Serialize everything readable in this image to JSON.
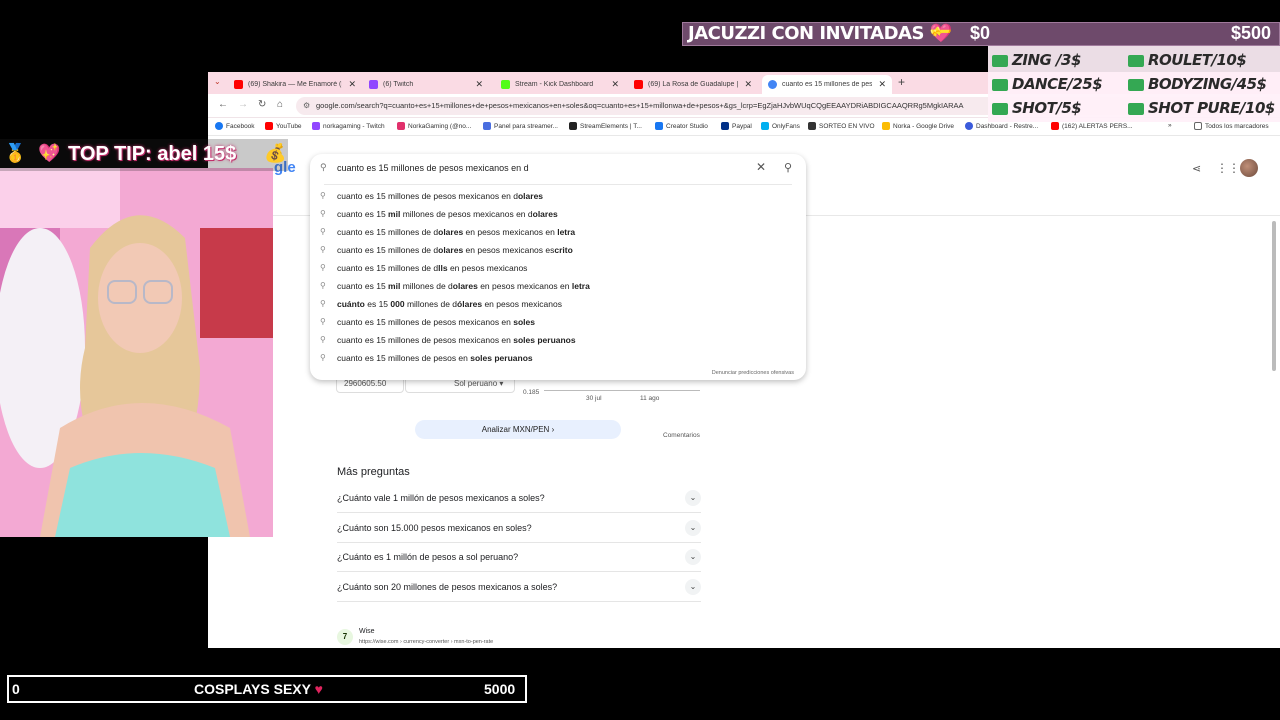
{
  "browser": {
    "tabs": [
      {
        "label": "(69) Shakira — Me Enamoré (Le",
        "color": "#ff0000"
      },
      {
        "label": "(6) Twitch",
        "color": "#9146ff"
      },
      {
        "label": "Stream - Kick Dashboard",
        "color": "#53fc18"
      },
      {
        "label": "(69) La Rosa de Guadalupe | EL",
        "color": "#ff0000"
      },
      {
        "label": "cuanto es 15 millones de pesos",
        "color": "#4285f4"
      }
    ],
    "url": "google.com/search?q=cuanto+es+15+millones+de+pesos+mexicanos+en+soles&oq=cuanto+es+15+millonwa+de+pesos+&gs_lcrp=EgZjaHJvbWUqCQgEEAAYDRiABDIGCAAQRRg5MgkIARAA",
    "bookmarks": [
      {
        "label": "Facebook",
        "color": "#1877f2"
      },
      {
        "label": "YouTube",
        "color": "#ff0000"
      },
      {
        "label": "norkagaming - Twitch",
        "color": "#9146ff"
      },
      {
        "label": "NorkaGaming (@no...",
        "color": "#e1306c"
      },
      {
        "label": "Panel para streamer...",
        "color": "#4a6ee0"
      },
      {
        "label": "StreamElements | T...",
        "color": "#222222"
      },
      {
        "label": "Creator Studio",
        "color": "#1877f2"
      },
      {
        "label": "Paypal",
        "color": "#003087"
      },
      {
        "label": "OnlyFans",
        "color": "#00aff0"
      },
      {
        "label": "SORTEO EN VIVO",
        "color": "#333333"
      },
      {
        "label": "Norka - Google Drive",
        "color": "#fbbc04"
      },
      {
        "label": "Dashboard - Restre...",
        "color": "#3b5bdb"
      },
      {
        "label": "(162) ALERTAS PERS...",
        "color": "#ff0000"
      }
    ],
    "all_bookmarks": "Todos los marcadores"
  },
  "search": {
    "logo": "gle",
    "query": "cuanto es 15 millones de pesos mexicanos en d",
    "suggestions": [
      {
        "plain": "cuanto es 15 millones de pesos mexicanos en d",
        "bold": "olares",
        "rest": ""
      },
      {
        "plain": "cuanto es 15 ",
        "bold": "mil",
        "rest": " millones de pesos mexicanos en d",
        "bold2": "olares"
      },
      {
        "plain": "cuanto es 15 millones de d",
        "bold": "olares",
        "rest": " en pesos mexicanos en ",
        "bold2": "letra"
      },
      {
        "plain": "cuanto es 15 millones de d",
        "bold": "olares",
        "rest": " en pesos mexicanos es",
        "bold2": "crito"
      },
      {
        "plain": "cuanto es 15 millones de d",
        "bold": "lls",
        "rest": " en pesos mexicanos"
      },
      {
        "plain": "cuanto es 15 ",
        "bold": "mil",
        "rest": " millones de d",
        "bold2": "olares",
        "rest2": " en pesos mexicanos en ",
        "bold3": "letra"
      },
      {
        "plain": "",
        "bold": "cuánto",
        "rest": " es 15 ",
        "bold2": "000",
        "rest2": " millones de d",
        "bold3": "ólares",
        "rest3": " en pesos mexicanos"
      },
      {
        "plain": "cuanto es 15 millones de pesos mexicanos en ",
        "bold": "soles",
        "rest": ""
      },
      {
        "plain": "cuanto es 15 millones de pesos mexicanos en ",
        "bold": "soles peruanos",
        "rest": ""
      },
      {
        "plain": "cuanto es 15 millones de pesos en ",
        "bold": "soles peruanos",
        "rest": ""
      }
    ],
    "report": "Denunciar predicciones ofensivas"
  },
  "converter": {
    "amount": "2960605.50",
    "currency": "Sol peruano",
    "chart_ylabel": "0.185",
    "chart_x1": "30 jul",
    "chart_x2": "11 ago",
    "analyze": "Analizar MXN/PEN",
    "comments": "Comentarios"
  },
  "more_questions": {
    "title": "Más preguntas",
    "items": [
      "¿Cuánto vale 1 millón de pesos mexicanos a soles?",
      "¿Cuánto son 15.000 pesos mexicanos en soles?",
      "¿Cuánto es 1 millón de pesos a sol peruano?",
      "¿Cuánto son 20 millones de pesos mexicanos a soles?"
    ]
  },
  "result": {
    "name": "Wise",
    "url": "https://wise.com › currency-converter › mxn-to-pen-rate"
  },
  "overlay": {
    "top_tip": "TOP TIP: abel 15$",
    "jacuzzi": {
      "title": "JACUZZI CON INVITADAS",
      "min": "$0",
      "max": "$500"
    },
    "menu": [
      "ZING /3$",
      "ROULET/10$",
      "DANCE/25$",
      "BODYZING/45$",
      "SHOT/5$",
      "SHOT PURE/10$"
    ],
    "goal": {
      "min": "0",
      "title": "COSPLAYS SEXY",
      "max": "5000"
    }
  }
}
